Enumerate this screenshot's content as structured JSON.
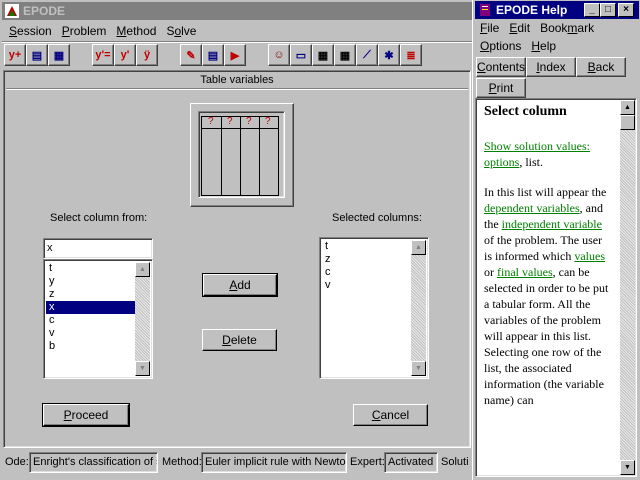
{
  "main": {
    "title": "EPODE",
    "menu": [
      {
        "pre": "",
        "u": "S",
        "post": "ession"
      },
      {
        "pre": "",
        "u": "P",
        "post": "roblem"
      },
      {
        "pre": "",
        "u": "M",
        "post": "ethod"
      },
      {
        "pre": "S",
        "u": "o",
        "post": "lve"
      }
    ],
    "toolbar": [
      {
        "name": "new-problem-tool",
        "icon": "y+",
        "color": "#c00000"
      },
      {
        "name": "open-problem-tool",
        "icon": "▤",
        "color": "#000080"
      },
      {
        "name": "save-problem-tool",
        "icon": "▦",
        "color": "#000080"
      },
      {
        "name": "equation-tool",
        "icon": "y'=",
        "color": "#c00000"
      },
      {
        "name": "equation-window-tool",
        "icon": "y'",
        "color": "#c00000"
      },
      {
        "name": "system-tool",
        "icon": "ÿ",
        "color": "#c00000"
      },
      {
        "name": "edit-tool",
        "icon": "✎",
        "color": "#c00000"
      },
      {
        "name": "table-settings-tool",
        "icon": "▤",
        "color": "#000080"
      },
      {
        "name": "run-tool",
        "icon": "▶",
        "color": "#c00000"
      },
      {
        "name": "user-tool",
        "icon": "☺",
        "color": "#800000"
      },
      {
        "name": "computer-tool",
        "icon": "▭",
        "color": "#000080"
      },
      {
        "name": "small-table-tool",
        "icon": "▦",
        "color": "#000"
      },
      {
        "name": "large-table-tool",
        "icon": "▦",
        "color": "#000"
      },
      {
        "name": "graph-tool",
        "icon": "⟋",
        "color": "#000080"
      },
      {
        "name": "phase-tool",
        "icon": "✱",
        "color": "#000080"
      },
      {
        "name": "stripe-tool",
        "icon": "≣",
        "color": "#c00000"
      }
    ],
    "panel_title": "Table variables",
    "preview_marks": [
      "?",
      "?",
      "?",
      "?"
    ],
    "select_from_label": "Select column from:",
    "selected_label": "Selected columns:",
    "filter_value": "x",
    "source_items": [
      "t",
      "y",
      "z",
      "x",
      "c",
      "v",
      "b"
    ],
    "source_selected_index": 3,
    "selected_items": [
      "t",
      "z",
      "c",
      "v"
    ],
    "add_pre": "",
    "add_u": "A",
    "add_post": "dd",
    "delete_pre": "",
    "delete_u": "D",
    "delete_post": "elete",
    "proceed_pre": "",
    "proceed_u": "P",
    "proceed_post": "roceed",
    "cancel_pre": "",
    "cancel_u": "C",
    "cancel_post": "ancel",
    "status": {
      "ode_label": "Ode:",
      "ode_value": "Enright's classification of st",
      "method_label": "Method:",
      "method_value": "Euler implicit rule with Newton",
      "expert_label": "Expert:",
      "expert_value": "Activated",
      "solution_label": "Soluti"
    }
  },
  "help": {
    "title": "EPODE Help",
    "menu": [
      {
        "pre": "",
        "u": "F",
        "post": "ile"
      },
      {
        "pre": "",
        "u": "E",
        "post": "dit"
      },
      {
        "pre": "Book",
        "u": "m",
        "post": "ark"
      },
      {
        "pre": "",
        "u": "O",
        "post": "ptions"
      },
      {
        "pre": "",
        "u": "H",
        "post": "elp"
      }
    ],
    "buttons": [
      {
        "pre": "",
        "u": "C",
        "post": "ontents"
      },
      {
        "pre": "",
        "u": "I",
        "post": "ndex"
      },
      {
        "pre": "",
        "u": "B",
        "post": "ack"
      },
      {
        "pre": "",
        "u": "P",
        "post": "rint"
      }
    ],
    "heading": "Select column",
    "link_show_solution": "Show solution values: options",
    "t1": ", list.",
    "t2": "In this list will appear the ",
    "link_dependent": "dependent variables",
    "t3": ", and the ",
    "link_independent": "independent variable",
    "t4": " of the problem. The user is informed which ",
    "link_values": "values",
    "t5": " or ",
    "link_final_values": "final values",
    "t6": ", can be selected in order to be put a tabular form. All the variables of the problem will appear in this list. Selecting one row of the list, the associated information (the variable name) can"
  },
  "colors": {
    "desktop": "#008080",
    "face": "#c0c0c0",
    "active_title": "#000080",
    "inactive_title": "#808080",
    "selection": "#000080",
    "help_link": "#008000",
    "preview_mark": "#c00000"
  }
}
